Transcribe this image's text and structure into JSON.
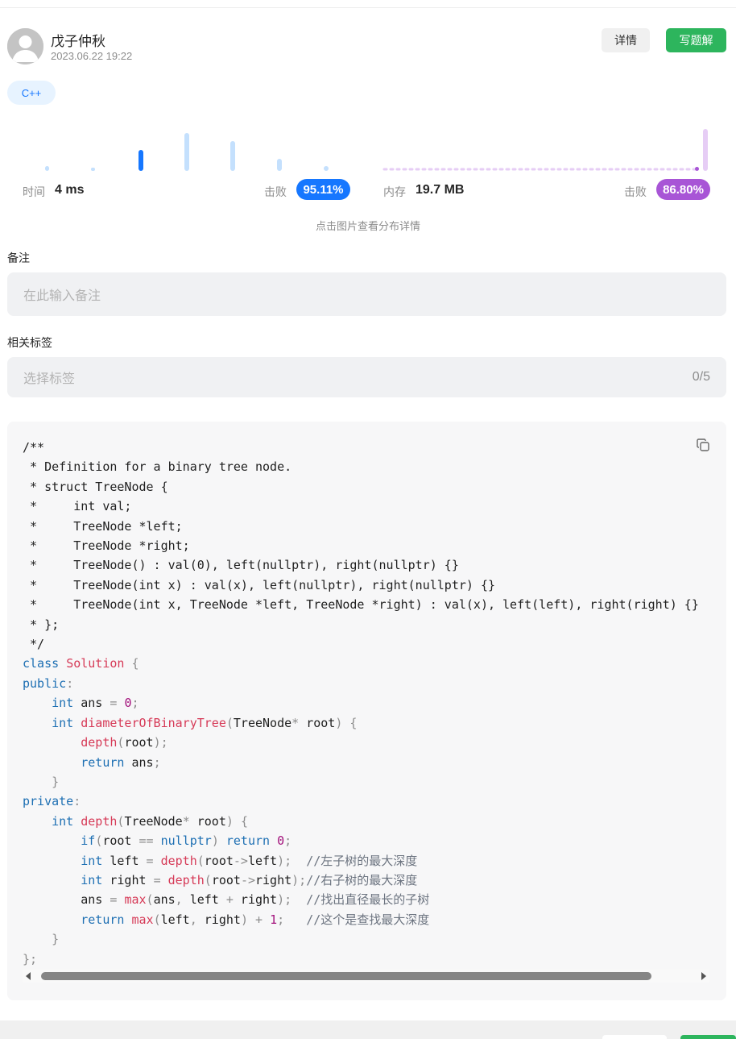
{
  "header": {
    "username": "戊子仲秋",
    "timestamp": "2023.06.22 19:22",
    "detail_label": "详情",
    "write_label": "写题解"
  },
  "language_tag": "C++",
  "stats": {
    "runtime_label": "时间",
    "runtime_value": "4 ms",
    "runtime_beat_label": "击败",
    "runtime_beat_value": "95.11%",
    "memory_label": "内存",
    "memory_value": "19.7 MB",
    "memory_beat_label": "击败",
    "memory_beat_value": "86.80%",
    "runtime_color": "#1677ff",
    "memory_color": "#a855d6",
    "hint": "点击图片查看分布详情"
  },
  "note": {
    "label": "备注",
    "placeholder": "在此输入备注"
  },
  "tags": {
    "label": "相关标签",
    "placeholder": "选择标签",
    "count": "0/5"
  },
  "code": {
    "copy_icon": "copy-icon",
    "lines": [
      "/**",
      " * Definition for a binary tree node.",
      " * struct TreeNode {",
      " *     int val;",
      " *     TreeNode *left;",
      " *     TreeNode *right;",
      " *     TreeNode() : val(0), left(nullptr), right(nullptr) {}",
      " *     TreeNode(int x) : val(x), left(nullptr), right(nullptr) {}",
      " *     TreeNode(int x, TreeNode *left, TreeNode *right) : val(x), left(left), right(right) {}",
      " * };",
      " */",
      "class Solution {",
      "public:",
      "    int ans = 0;",
      "    int diameterOfBinaryTree(TreeNode* root) {",
      "        depth(root);",
      "        return ans;",
      "    }",
      "private:",
      "    int depth(TreeNode* root) {",
      "        if(root == nullptr) return 0;",
      "        int left = depth(root->left);  //左子树的最大深度",
      "        int right = depth(root->right);//右子树的最大深度",
      "        ans = max(ans, left + right);  //找出直径最长的子树",
      "        return max(left, right) + 1;   //这个是查找最大深度",
      "    }",
      "};"
    ]
  }
}
